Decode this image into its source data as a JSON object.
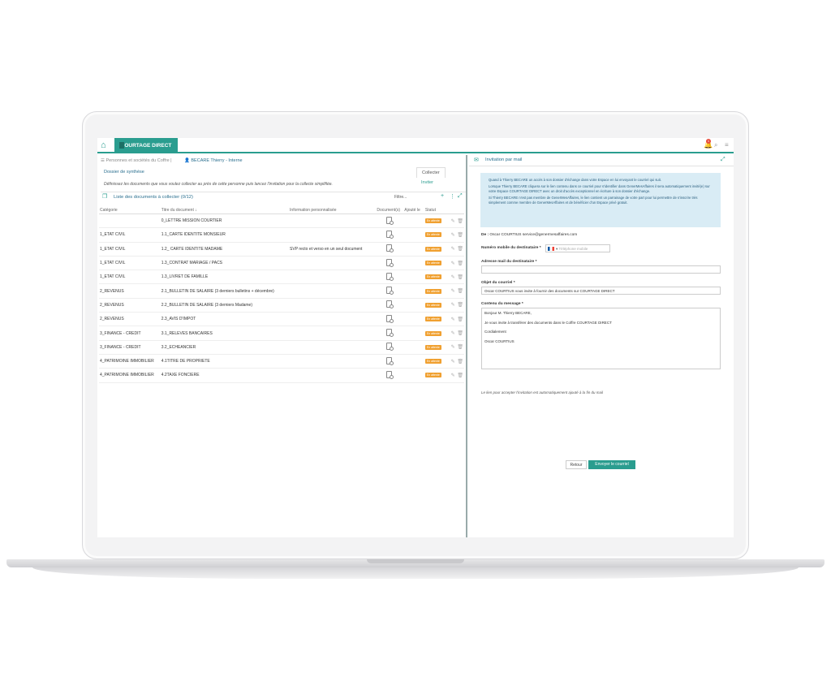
{
  "topbar": {
    "brand": "COURTAGE DIRECT",
    "notification_count": "1"
  },
  "left": {
    "breadcrumb_root": "Personnes et sociétés du Coffre",
    "breadcrumb_user": "BECARE Thierry - Interne",
    "dossier_link": "Dossier de synthèse",
    "tabs": [
      "Collecter",
      "Inviter"
    ],
    "hint": "Définissez les documents que vous voulez collecter au près de cette personne puis lancez l'invitation pour la collecte simplifiée.",
    "list_title": "Liste des documents à collecter (0/12)",
    "filter": "Filtre...",
    "columns": [
      "Catégorie",
      "Titre du document",
      "Information personnalisée",
      "Document(s)",
      "Ajouté le",
      "Statut"
    ],
    "rows": [
      {
        "cat": "",
        "title": "0_LETTRE MISSION COURTIER",
        "info": "",
        "status": "En attente"
      },
      {
        "cat": "1_ETAT CIVIL",
        "title": "1.1_CARTE IDENTITE MONSIEUR",
        "info": "",
        "status": "En attente"
      },
      {
        "cat": "1_ETAT CIVIL",
        "title": "1.2_ CARTE IDENTITE MADAME",
        "info": "SVP recto et verso en un seul document",
        "status": "En attente"
      },
      {
        "cat": "1_ETAT CIVIL",
        "title": "1.3_CONTRAT MARIAGE / PACS",
        "info": "",
        "status": "En attente"
      },
      {
        "cat": "1_ETAT CIVIL",
        "title": "1.3_LIVRET DE FAMILLE",
        "info": "",
        "status": "En attente"
      },
      {
        "cat": "2_REVENUS",
        "title": "2.1_BULLETIN DE SALAIRE (3 derniers bulletins + décembre)",
        "info": "",
        "status": "En attente"
      },
      {
        "cat": "2_REVENUS",
        "title": "2.2_BULLETIN DE SALAIRE (3 derniers Madame)",
        "info": "",
        "status": "En attente"
      },
      {
        "cat": "2_REVENUS",
        "title": "2.3_AVIS D'IMPOT",
        "info": "",
        "status": "En attente"
      },
      {
        "cat": "3_FINANCE - CREDIT",
        "title": "3.1_RELEVES BANCAIRES",
        "info": "",
        "status": "En attente"
      },
      {
        "cat": "3_FINANCE - CREDIT",
        "title": "3.2_ECHEANCIER",
        "info": "",
        "status": "En attente"
      },
      {
        "cat": "4_PATRIMOINE IMMOBILIER",
        "title": "4.1TITRE DE PROPRIETE",
        "info": "",
        "status": "En attente"
      },
      {
        "cat": "4_PATRIMOINE IMMOBILIER",
        "title": "4.2TAXE FONCIERE",
        "info": "",
        "status": "En attente"
      }
    ]
  },
  "right": {
    "title": "Invitation par mail",
    "info_p1": "Quand à Thierry BECARE un accès à son dossier d'échange dans votre Espace en lui envoyant le courriel qui suit.",
    "info_p2": "Lorsque Thierry BECARE cliquera sur le lien contenu dans ce courriel pour s'identifier dans GenerMesAffaires il sera automatiquement invité(e) sur votre Espace COURTAGE DIRECT avec un droit d'accès exceptionnel en écriture à son dossier d'échange.",
    "info_p3": "Si Thierry BECARE n'est pas membre de GenerMesAffaires, le lien contient un parrainage de votre part pour lui permettre de s'inscrire très simplement comme membre de GenerMesAffaires et de bénéficier d'un Espace privé gratuit.",
    "from_label": "De :",
    "from_value": "Oscar COURTIUS service@genermesaffaires.com",
    "phone_label": "Numéro mobile du destinataire *",
    "phone_placeholder": "Téléphone mobile",
    "email_label": "Adresse mail du destinataire *",
    "subject_label": "Objet du courriel *",
    "subject_value": "Oscar COURTIUS vous invite à fournir des documents sur COURTAGE DIRECT",
    "message_label": "Contenu du message *",
    "message_lines": [
      "Bonjour M. Thierry BECARE,",
      "Je vous invite à transférer des documents dans le Coffre COURTAGE DIRECT",
      "Cordialement",
      "Oscar COURTIUS"
    ],
    "note": "Le lien pour accepter l'invitation est automatiquement ajouté à la fin du mail",
    "btn_back": "Retour",
    "btn_send": "Envoyer le courriel"
  },
  "colors": {
    "accent": "#2a9d8f",
    "status": "#f0a030",
    "info_bg": "#d9ecf5"
  }
}
